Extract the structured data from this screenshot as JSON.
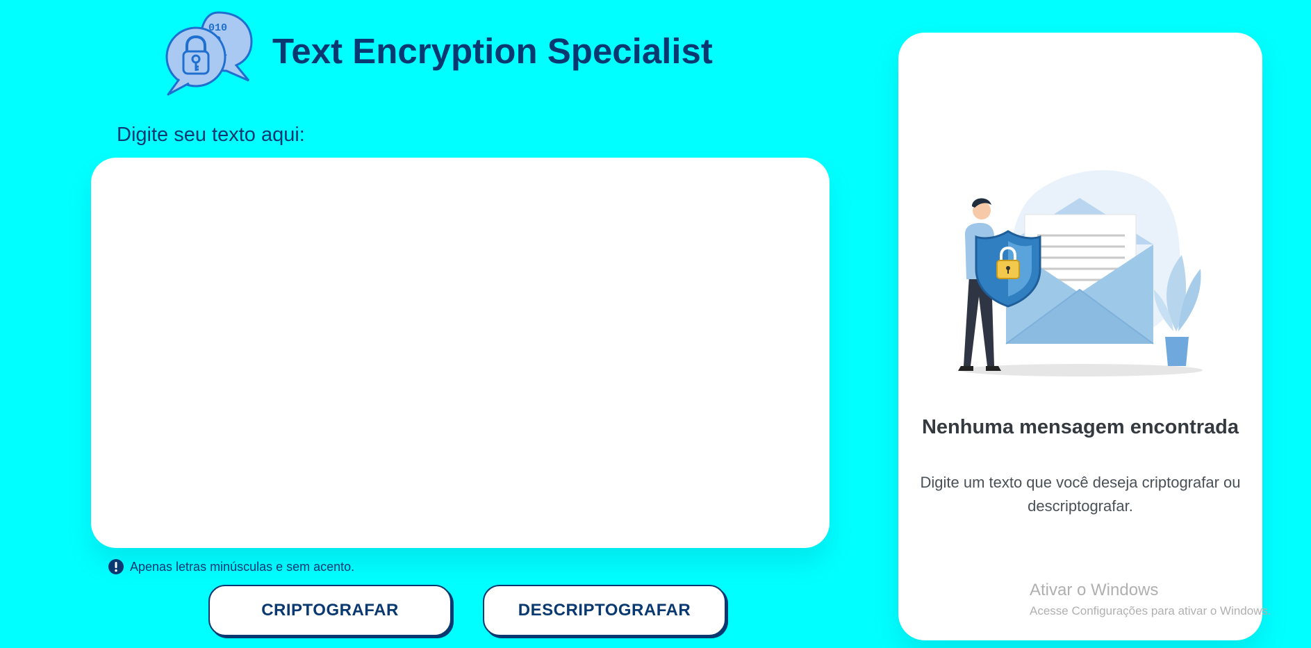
{
  "header": {
    "title": "Text Encryption Specialist",
    "logo_icon": "encrypted-chat-icon"
  },
  "input": {
    "label": "Digite seu texto aqui:",
    "value": "",
    "placeholder": ""
  },
  "hint": {
    "icon": "exclamation-circle-icon",
    "text": "Apenas letras minúsculas e sem acento."
  },
  "buttons": {
    "encrypt_label": "CRIPTOGRAFAR",
    "decrypt_label": "DESCRIPTOGRAFAR"
  },
  "output": {
    "illustration_icon": "man-shield-envelope-illustration",
    "empty_title": "Nenhuma mensagem encontrada",
    "empty_description": "Digite um texto que você deseja criptografar ou descriptografar."
  },
  "watermark": {
    "title": "Ativar o Windows",
    "subtitle": "Acesse Configurações para ativar o Windows."
  },
  "colors": {
    "background": "#00FFFF",
    "primary": "#0A3871",
    "panel": "#FFFFFF"
  }
}
